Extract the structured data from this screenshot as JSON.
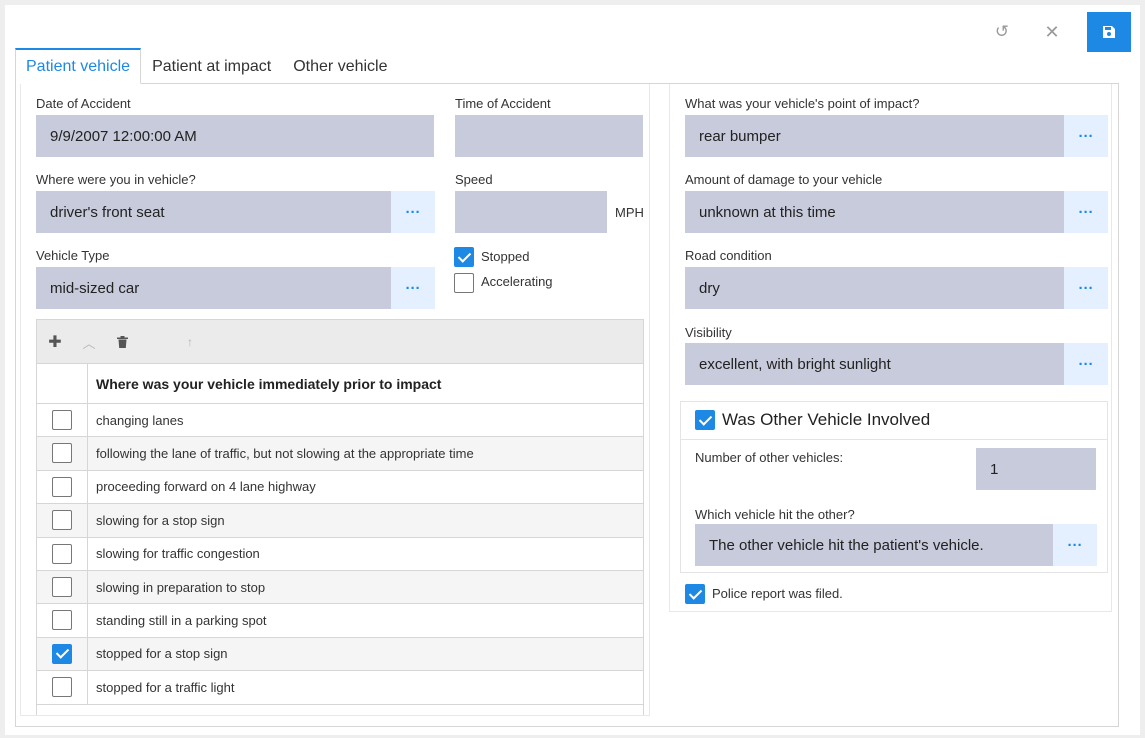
{
  "toolbar": {
    "undo_icon": "undo-icon",
    "close_icon": "close-icon",
    "save_icon": "save-icon",
    "undo_glyph": "↺",
    "close_glyph": "✕",
    "save_glyph": "💾"
  },
  "tabs": [
    {
      "label": "Patient vehicle",
      "active": true
    },
    {
      "label": "Patient at impact",
      "active": false
    },
    {
      "label": "Other vehicle",
      "active": false
    }
  ],
  "left": {
    "date_label": "Date of Accident",
    "date_value": "9/9/2007 12:00:00 AM",
    "time_label": "Time of Accident",
    "time_value": "",
    "position_label": "Where were you in vehicle?",
    "position_value": "driver's front seat",
    "speed_label": "Speed",
    "speed_value": "",
    "speed_unit": "MPH",
    "vehicle_type_label": "Vehicle Type",
    "vehicle_type_value": "mid-sized car",
    "stopped_label": "Stopped",
    "stopped_checked": true,
    "accelerating_label": "Accelerating",
    "accelerating_checked": false,
    "dots": "···"
  },
  "grid": {
    "tools": {
      "add": "✚",
      "collapse": "︿",
      "delete": "🗑",
      "up": "↑"
    },
    "header": "Where was your vehicle immediately prior to impact",
    "rows": [
      {
        "label": "changing lanes",
        "checked": false
      },
      {
        "label": "following the lane of traffic, but not slowing at the appropriate time",
        "checked": false
      },
      {
        "label": "proceeding forward on 4 lane highway",
        "checked": false
      },
      {
        "label": "slowing for a stop sign",
        "checked": false
      },
      {
        "label": "slowing for traffic congestion",
        "checked": false
      },
      {
        "label": "slowing in preparation to stop",
        "checked": false
      },
      {
        "label": "standing still in a parking spot",
        "checked": false
      },
      {
        "label": "stopped for a stop sign",
        "checked": true
      },
      {
        "label": "stopped for a traffic light",
        "checked": false
      }
    ]
  },
  "right": {
    "impact_label": "What was your vehicle's point of impact?",
    "impact_value": "rear bumper",
    "damage_label": "Amount of damage to your vehicle",
    "damage_value": "unknown at this time",
    "road_label": "Road condition",
    "road_value": "dry",
    "visibility_label": "Visibility",
    "visibility_value": "excellent, with bright sunlight",
    "other_involved_label": "Was Other Vehicle Involved",
    "other_involved_checked": true,
    "num_other_label": "Number of other vehicles:",
    "num_other_value": "1",
    "hit_label": "Which vehicle hit the other?",
    "hit_value": "The other vehicle hit the patient's vehicle.",
    "police_label": "Police report was filed.",
    "police_checked": true
  },
  "colors": {
    "accent": "#1e88e5",
    "field_bg": "#c7cbdb",
    "dots_bg": "#e4efff"
  }
}
